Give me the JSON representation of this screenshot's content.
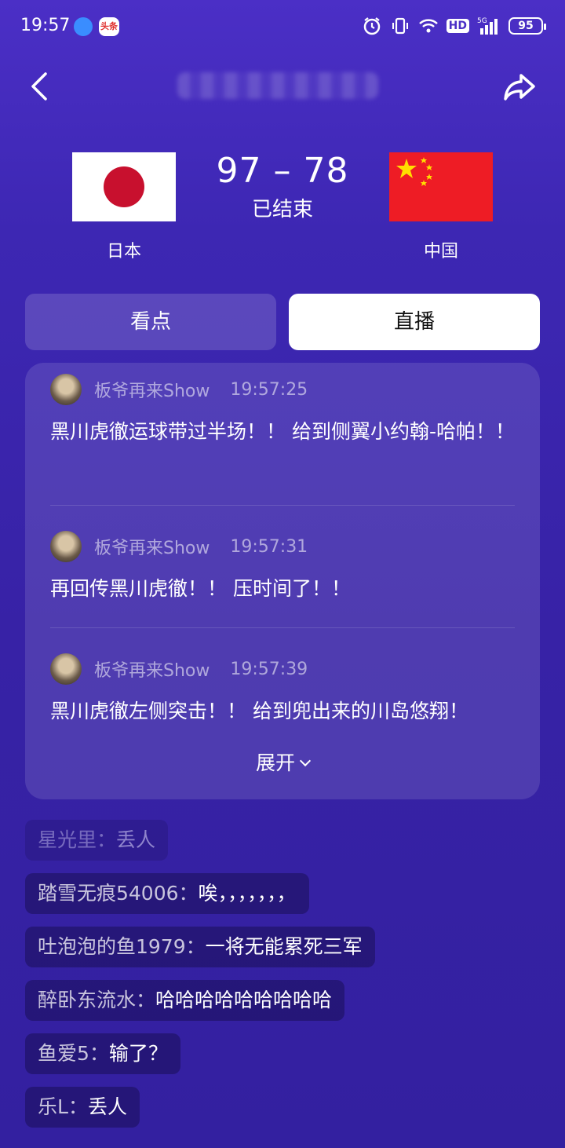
{
  "status_bar": {
    "time": "19:57",
    "app_badge": "头条",
    "network": "5G",
    "hd": "HD",
    "battery": "95"
  },
  "header": {
    "back_icon": "chevron-left-icon",
    "share_icon": "share-arrow-icon"
  },
  "match": {
    "home_team": "日本",
    "away_team": "中国",
    "score": "97 – 78",
    "status": "已结束",
    "home_flag": "japan-flag",
    "away_flag": "china-flag"
  },
  "tabs": [
    {
      "label": "看点",
      "active": false
    },
    {
      "label": "直播",
      "active": true
    }
  ],
  "live_feed": {
    "entries": [
      {
        "author": "板爷再来Show",
        "time": "19:57:25",
        "text": "黑川虎徹运球带过半场！！ 给到侧翼小约翰-哈帕！！"
      },
      {
        "author": "板爷再来Show",
        "time": "19:57:31",
        "text": "再回传黑川虎徹！！ 压时间了！！"
      },
      {
        "author": "板爷再来Show",
        "time": "19:57:39",
        "text": "黑川虎徹左侧突击！！ 给到兜出来的川岛悠翔！"
      }
    ],
    "expand_label": "展开"
  },
  "comments": [
    {
      "user": "星光里：",
      "text": "丢人"
    },
    {
      "user": "踏雪无痕54006：",
      "text": "唉，，，，，，，"
    },
    {
      "user": "吐泡泡的鱼1979：",
      "text": "一将无能累死三军"
    },
    {
      "user": "醉卧东流水：",
      "text": "哈哈哈哈哈哈哈哈哈"
    },
    {
      "user": "鱼爱5：",
      "text": "输了？"
    },
    {
      "user": "乐L：",
      "text": "丢人"
    }
  ],
  "colors": {
    "background": "#3d27b3",
    "japan_red": "#c8102e",
    "china_red": "#ee1c25",
    "china_star": "#ffde00"
  }
}
